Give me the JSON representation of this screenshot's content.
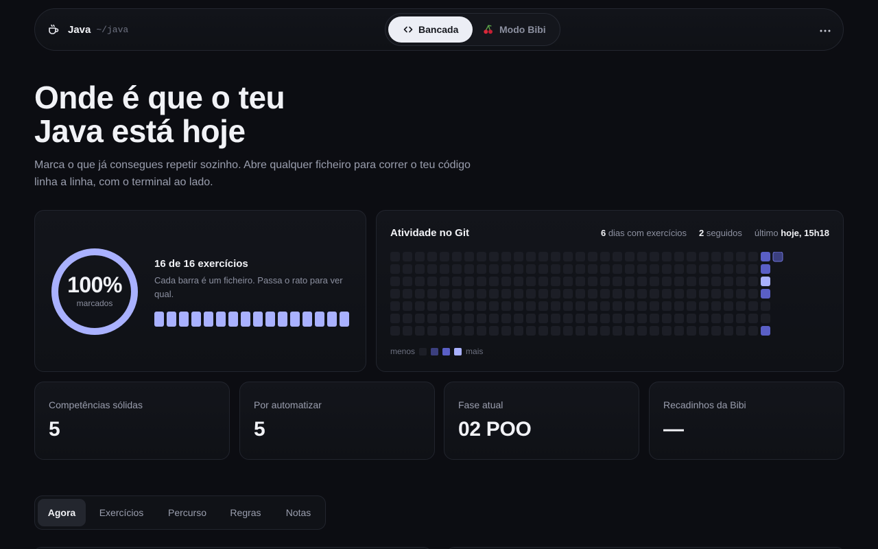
{
  "header": {
    "title": "Java",
    "path": "~/java",
    "brand_icon": "coffee-cup-icon",
    "modes": [
      {
        "label": "Bancada",
        "icon": "code-brackets-icon",
        "active": true
      },
      {
        "label": "Modo Bibi",
        "icon": "cherry-icon",
        "active": false
      }
    ],
    "more_icon": "more-horizontal-icon"
  },
  "hero": {
    "title_line1": "Onde é que o teu",
    "title_line2": "Java está hoje",
    "subtitle": "Marca o que já consegues repetir sozinho. Abre qualquer ficheiro para correr o teu código linha a linha, com o terminal ao lado."
  },
  "progress": {
    "percent_text": "100%",
    "percent": 100,
    "percent_label": "marcados",
    "title": "16 de 16 exercícios",
    "description": "Cada barra é um ficheiro. Passa o rato para ver qual.",
    "files_total": 16,
    "files_done": 16,
    "bar_color": "#a9b1ff",
    "ring_color": "#a9b1ff",
    "ring_track": "#2a2d3a"
  },
  "git": {
    "title": "Atividade no Git",
    "days_value": "6",
    "days_label": "dias com exercícios",
    "streak_value": "2",
    "streak_label": "seguidos",
    "last_label": "último",
    "last_value": "hoje, 15h18",
    "legend_less": "menos",
    "legend_more": "mais",
    "levels": [
      "#1c1e26",
      "#3b3f7e",
      "#5a5fc6",
      "#a9b1ff"
    ],
    "weeks": 31,
    "active": [
      {
        "week": 30,
        "day": 0,
        "level": 2
      },
      {
        "week": 30,
        "day": 1,
        "level": 2
      },
      {
        "week": 30,
        "day": 2,
        "level": 3
      },
      {
        "week": 30,
        "day": 3,
        "level": 2
      },
      {
        "week": 30,
        "day": 6,
        "level": 2
      },
      {
        "week": 31,
        "day": 0,
        "level": 1
      }
    ]
  },
  "stats": [
    {
      "label": "Competências sólidas",
      "value": "5"
    },
    {
      "label": "Por automatizar",
      "value": "5"
    },
    {
      "label": "Fase atual",
      "value": "02 POO"
    },
    {
      "label": "Recadinhos da Bibi",
      "value": "—"
    }
  ],
  "tabs": [
    {
      "label": "Agora",
      "active": true
    },
    {
      "label": "Exercícios",
      "active": false
    },
    {
      "label": "Percurso",
      "active": false
    },
    {
      "label": "Regras",
      "active": false
    },
    {
      "label": "Notas",
      "active": false
    }
  ]
}
